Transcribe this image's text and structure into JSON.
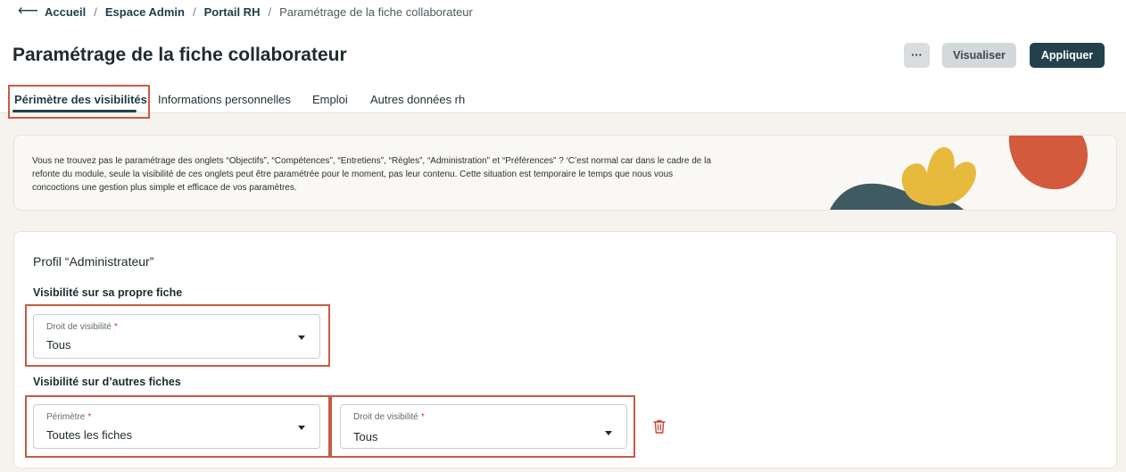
{
  "breadcrumb": {
    "items": [
      "Accueil",
      "Espace Admin",
      "Portail RH"
    ],
    "separator": "/",
    "current": "Paramétrage de la fiche collaborateur"
  },
  "page": {
    "title": "Paramétrage de la fiche collaborateur"
  },
  "actions": {
    "more_label": "···",
    "visualiser_label": "Visualiser",
    "appliquer_label": "Appliquer"
  },
  "tabs": [
    {
      "label": "Périmètre des visibilités",
      "active": true
    },
    {
      "label": "Informations personnelles"
    },
    {
      "label": "Emploi"
    },
    {
      "label": "Autres données rh"
    }
  ],
  "info": {
    "lines": [
      "Vous ne trouvez pas le paramétrage des onglets “Objectifs”, “Compétences”, “Entretiens”, “Règles”, “Administration” et “Préférences” ? ‘C’est normal car dans le cadre de la",
      "refonte du module, seule la visibilité de ces onglets peut être paramétrée pour le moment, pas leur contenu. Cette situation est temporaire le temps que nous vous",
      "concoctions une gestion plus simple et efficace de vos paramètres."
    ]
  },
  "profile": {
    "title": "Profil “Administrateur”",
    "own_section": {
      "label": "Visibilité sur sa propre fiche",
      "field": {
        "label": "Droit de visibilité",
        "required": "*",
        "value": "Tous"
      }
    },
    "others_section": {
      "label": "Visibilité sur d’autres fiches",
      "perimetre": {
        "label": "Périmètre",
        "required": "*",
        "value": "Toutes les fiches"
      },
      "droit": {
        "label": "Droit de visibilité",
        "required": "*",
        "value": "Tous"
      }
    }
  },
  "colors": {
    "primary": "#23414b",
    "highlight": "#c85a45",
    "danger": "#c8412f",
    "art_slate": "#3f5a60",
    "art_yellow": "#e7b93d",
    "art_red": "#d45a3e"
  },
  "icons": {
    "back": "arrow-left-icon",
    "caret": "caret-down-icon",
    "delete": "trash-icon"
  }
}
